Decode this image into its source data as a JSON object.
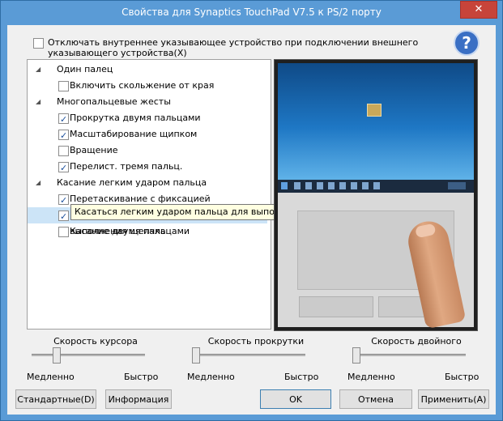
{
  "window": {
    "title": "Свойства для Synaptics TouchPad V7.5 к PS/2 порту",
    "close_label": "✕"
  },
  "top_option": {
    "label": "Отключать внутреннее указывающее устройство при подключении внешнего указывающего устройства(X)",
    "checked": false
  },
  "help": {
    "glyph": "?"
  },
  "tree": {
    "groups": [
      {
        "label": "Один палец",
        "items": [
          {
            "label": "Включить скольжение от края",
            "checked": false
          }
        ]
      },
      {
        "label": "Многопальцевые жесты",
        "items": [
          {
            "label": "Прокрутка двумя пальцами",
            "checked": true
          },
          {
            "label": "Масштабирование щипком",
            "checked": true
          },
          {
            "label": "Вращение",
            "checked": false
          },
          {
            "label": "Перелист. тремя пальц.",
            "checked": true
          }
        ]
      },
      {
        "label": "Касание легким ударом пальца",
        "items": [
          {
            "label": "Перетаскивание с фиксацией",
            "checked": true
          },
          {
            "label": "Касаться легким ударом пальца для выполнения щелчка",
            "checked": true
          },
          {
            "label": "Касание двумя пальцами",
            "checked": false
          }
        ]
      }
    ]
  },
  "tooltip": {
    "text": "Касаться легким ударом пальца для выполнения щелчка"
  },
  "sliders": [
    {
      "title": "Скорость курсора",
      "min_label": "Медленно",
      "max_label": "Быстро",
      "value": 0.2
    },
    {
      "title": "Скорость прокрутки",
      "min_label": "Медленно",
      "max_label": "Быстро",
      "value": 0.0
    },
    {
      "title": "Скорость двойного",
      "min_label": "Медленно",
      "max_label": "Быстро",
      "value": 0.0
    }
  ],
  "buttons": {
    "defaults": "Стандартные(D)",
    "info": "Информация",
    "ok": "OK",
    "cancel": "Отмена",
    "apply": "Применить(A)"
  },
  "colors": {
    "titlebar": "#5a9bd6",
    "close": "#c7443a",
    "selection": "#cce4f7"
  }
}
